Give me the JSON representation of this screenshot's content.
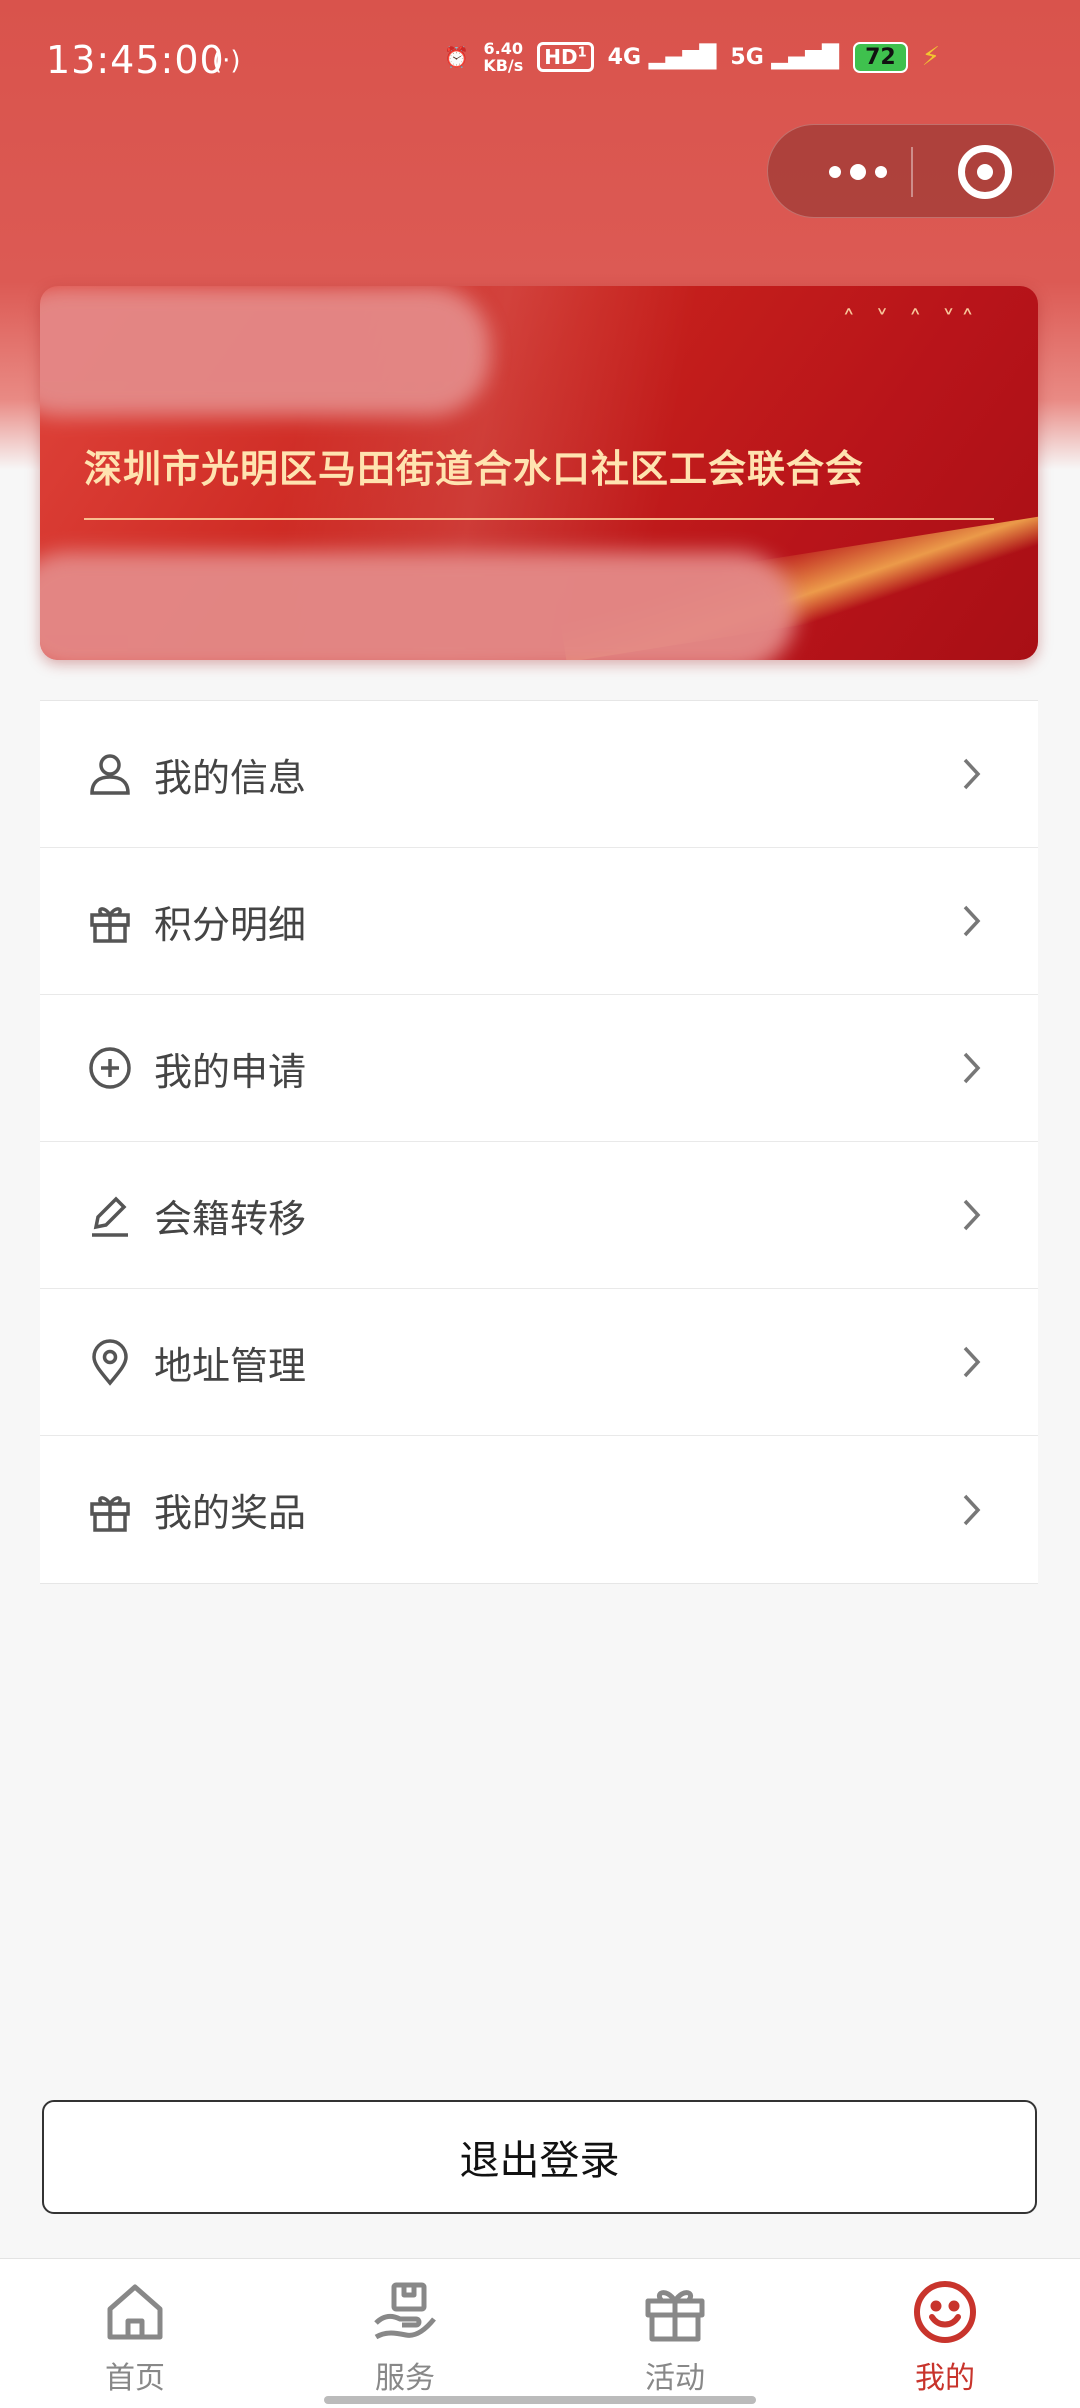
{
  "status_bar": {
    "time": "13:45:00",
    "hotspot_icon": "(·)",
    "alarm_icon": "⏰",
    "net_speed_value": "6.40",
    "net_speed_unit": "KB/s",
    "hd_label": "HD",
    "hd_sim": "1",
    "signal_4g": "4G",
    "signal_5g": "5G",
    "battery": "72",
    "charging_icon": "⚡"
  },
  "capsule": {
    "more_icon": "more-dots-icon",
    "close_icon": "target-circle-icon"
  },
  "banner": {
    "title": "深圳市光明区马田街道合水口社区工会联合会",
    "birds": "˄ ˅ ˄  ˅˄"
  },
  "menu": [
    {
      "label": "我的信息",
      "icon": "user-icon"
    },
    {
      "label": "积分明细",
      "icon": "gift-icon"
    },
    {
      "label": "我的申请",
      "icon": "plus-circle-icon"
    },
    {
      "label": "会籍转移",
      "icon": "pencil-icon"
    },
    {
      "label": "地址管理",
      "icon": "location-pin-icon"
    },
    {
      "label": "我的奖品",
      "icon": "gift-icon"
    }
  ],
  "logout_label": "退出登录",
  "tabbar": {
    "tabs": [
      {
        "label": "首页",
        "icon": "home-icon"
      },
      {
        "label": "服务",
        "icon": "service-hand-icon"
      },
      {
        "label": "活动",
        "icon": "gift-icon"
      },
      {
        "label": "我的",
        "icon": "smiley-icon"
      }
    ],
    "active_index": 3,
    "active_color": "#c8342c",
    "inactive_color": "#888888"
  }
}
